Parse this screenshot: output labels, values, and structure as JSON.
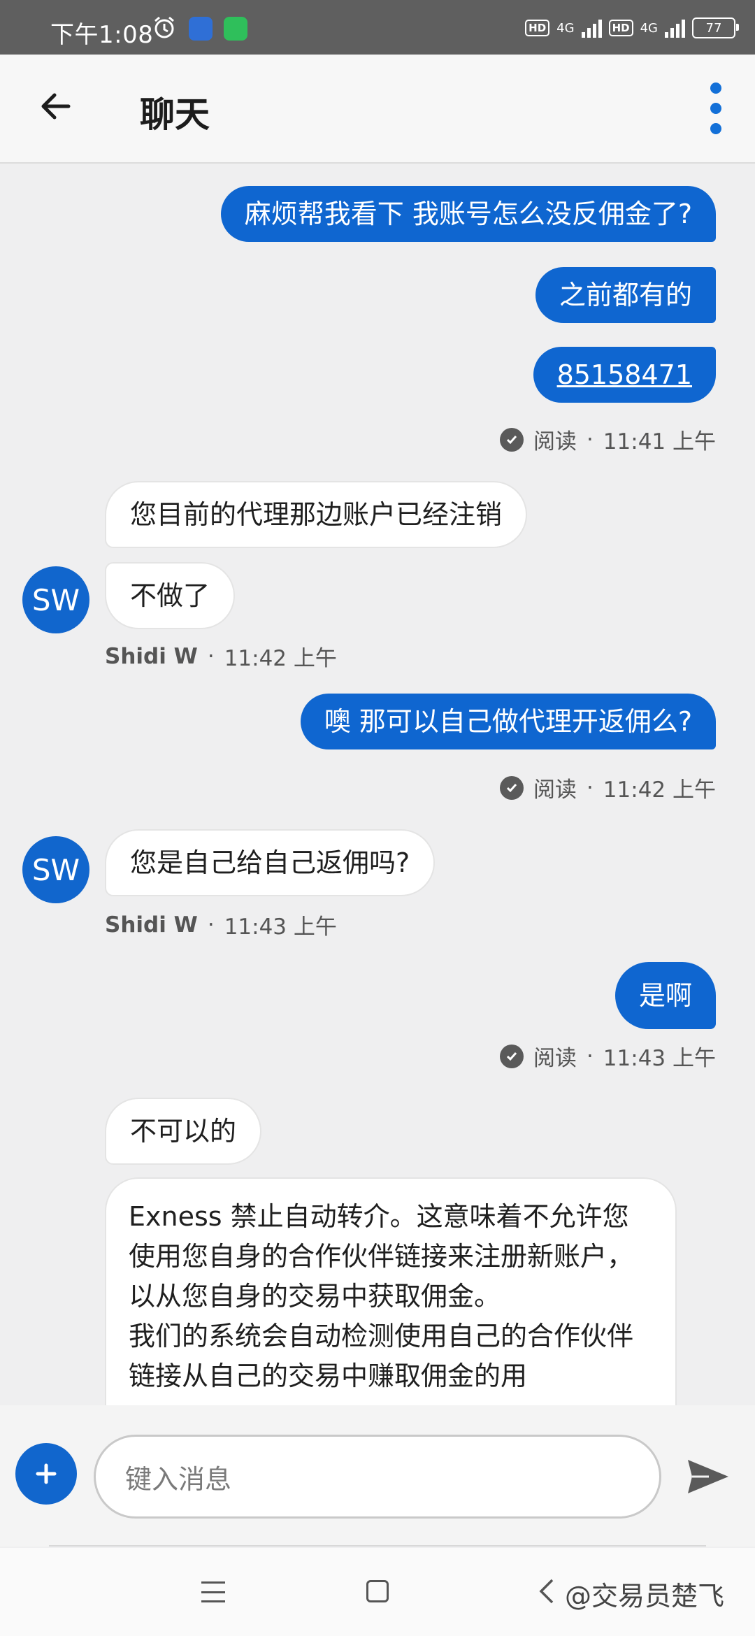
{
  "status_bar": {
    "time": "下午1:08",
    "hd1": "HD",
    "net1": "4G",
    "hd2": "HD",
    "net2": "4G",
    "battery": "77"
  },
  "header": {
    "title": "聊天",
    "back_icon": "arrow-left-icon",
    "menu_icon": "more-vertical-icon"
  },
  "messages": {
    "m1": "麻烦帮我看下 我账号怎么没反佣金了?",
    "m2": "之前都有的",
    "m3": "85158471",
    "read1_status": "阅读",
    "read1_sep": "·",
    "read1_time": "11:41 上午",
    "m4": "您目前的代理那边账户已经注销",
    "m5": "不做了",
    "avatar1": "SW",
    "sender1": "Shidi W",
    "sender1_sep": "·",
    "sender1_time": "11:42 上午",
    "m6": "噢 那可以自己做代理开返佣么?",
    "read2_status": "阅读",
    "read2_sep": "·",
    "read2_time": "11:42 上午",
    "m7": "您是自己给自己返佣吗?",
    "avatar2": "SW",
    "sender2": "Shidi W",
    "sender2_sep": "·",
    "sender2_time": "11:43 上午",
    "m8": "是啊",
    "read3_status": "阅读",
    "read3_sep": "·",
    "read3_time": "11:43 上午",
    "m9": "不可以的",
    "m10": "Exness 禁止自动转介。这意味着不允许您使用您自身的合作伙伴链接来注册新账户，以从您自身的交易中获取佣金。\n我们的系统会自动检测使用自己的合作伙伴链接从自己的交易中赚取佣金的用"
  },
  "composer": {
    "placeholder": "键入消息",
    "add_icon": "plus-icon",
    "send_icon": "send-icon"
  },
  "navbar": {
    "watermark": "@交易员楚飞"
  },
  "colors": {
    "accent": "#1166cd",
    "outgoing_bubble": "#0f66d0",
    "background": "#efeff0"
  }
}
